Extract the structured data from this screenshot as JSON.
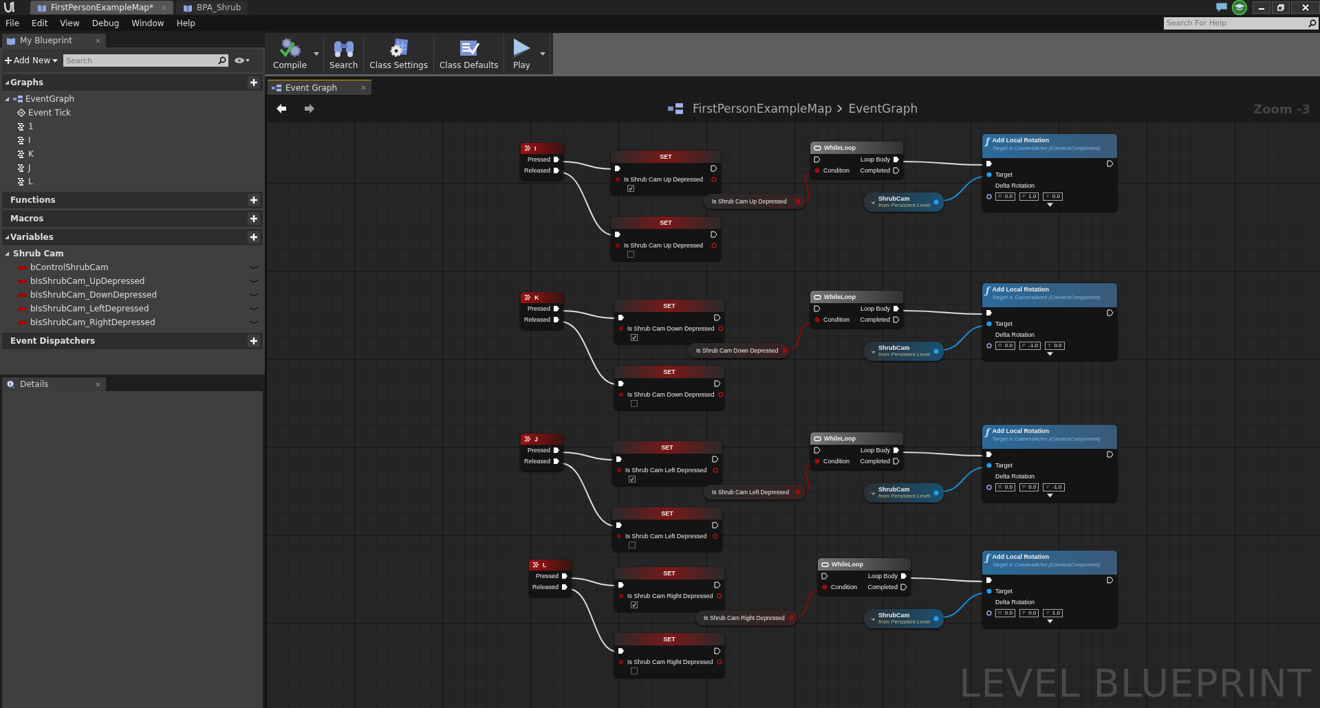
{
  "tabs": [
    {
      "label": "FirstPersonExampleMap*",
      "selected": true
    },
    {
      "label": "BPA_Shrub",
      "selected": false
    }
  ],
  "menu": [
    "File",
    "Edit",
    "View",
    "Debug",
    "Window",
    "Help"
  ],
  "help_search": {
    "placeholder": "Search For Help"
  },
  "my_blueprint": {
    "tab": "My Blueprint",
    "add_new": "Add New",
    "search": {
      "placeholder": "Search"
    },
    "sections": [
      {
        "title": "Graphs",
        "expanded": true,
        "graphs": [
          {
            "label": "EventGraph",
            "expanded": true,
            "children": [
              {
                "label": "Event Tick",
                "kind": "event"
              },
              {
                "label": "1",
                "kind": "key"
              },
              {
                "label": "I",
                "kind": "key"
              },
              {
                "label": "K",
                "kind": "key"
              },
              {
                "label": "J",
                "kind": "key"
              },
              {
                "label": "L",
                "kind": "key"
              }
            ]
          }
        ]
      },
      {
        "title": "Functions",
        "expanded": false
      },
      {
        "title": "Macros",
        "expanded": false
      },
      {
        "title": "Variables",
        "expanded": true,
        "categories": [
          {
            "label": "Shrub Cam",
            "expanded": true,
            "variables": [
              "bControlShrubCam",
              "bIsShrubCam_UpDepressed",
              "bIsShrubCam_DownDepressed",
              "bIsShrubCam_LeftDepressed",
              "bIsShrubCam_RightDepressed"
            ]
          }
        ]
      },
      {
        "title": "Event Dispatchers",
        "expanded": false
      }
    ]
  },
  "details": {
    "tab": "Details"
  },
  "toolbar": [
    {
      "label": "Compile",
      "kind": "compile",
      "dropdown": true
    },
    {
      "label": "Search",
      "kind": "search",
      "dropdown": false
    },
    {
      "label": "Class Settings",
      "kind": "settings",
      "dropdown": false
    },
    {
      "label": "Class Defaults",
      "kind": "defaults",
      "dropdown": false
    },
    {
      "label": "Play",
      "kind": "play",
      "dropdown": true
    }
  ],
  "graph_tab": "Event Graph",
  "breadcrumb": [
    "FirstPersonExampleMap",
    "EventGraph"
  ],
  "zoom": "Zoom -3",
  "graph_label": "LEVEL BLUEPRINT",
  "rows": [
    {
      "key": {
        "title": "I",
        "pressed": "Pressed",
        "released": "Released"
      },
      "set_pressed": {
        "title": "SET",
        "variable": "Is Shrub Cam Up Depressed",
        "checked": true
      },
      "set_released": {
        "title": "SET",
        "variable": "Is Shrub Cam Up Depressed",
        "checked": false
      },
      "getter": "Is Shrub Cam Up Depressed",
      "loop": {
        "title": "WhileLoop",
        "loop_body": "Loop Body",
        "condition": "Condition",
        "completed": "Completed"
      },
      "target": {
        "name": "ShrubCam",
        "source": "from Persistent Level"
      },
      "function": {
        "icon": "ƒ",
        "title": "Add Local Rotation",
        "subtitle": "Target is CameraActor (CameraComponent)",
        "target": "Target",
        "param": "Delta Rotation",
        "fields": [
          {
            "label": "R",
            "value": "0.0"
          },
          {
            "label": "P",
            "value": "1.0"
          },
          {
            "label": "Y",
            "value": "0.0"
          }
        ]
      }
    },
    {
      "key": {
        "title": "K",
        "pressed": "Pressed",
        "released": "Released"
      },
      "set_pressed": {
        "title": "SET",
        "variable": "Is Shrub Cam Down Depressed",
        "checked": true
      },
      "set_released": {
        "title": "SET",
        "variable": "Is Shrub Cam Down Depressed",
        "checked": false
      },
      "getter": "Is Shrub Cam Down Depressed",
      "loop": {
        "title": "WhileLoop",
        "loop_body": "Loop Body",
        "condition": "Condition",
        "completed": "Completed"
      },
      "target": {
        "name": "ShrubCam",
        "source": "from Persistent Level"
      },
      "function": {
        "icon": "ƒ",
        "title": "Add Local Rotation",
        "subtitle": "Target is CameraActor (CameraComponent)",
        "target": "Target",
        "param": "Delta Rotation",
        "fields": [
          {
            "label": "R",
            "value": "0.0"
          },
          {
            "label": "P",
            "value": "-1.0"
          },
          {
            "label": "Y",
            "value": "0.0"
          }
        ]
      }
    },
    {
      "key": {
        "title": "J",
        "pressed": "Pressed",
        "released": "Released"
      },
      "set_pressed": {
        "title": "SET",
        "variable": "Is Shrub Cam Left Depressed",
        "checked": true
      },
      "set_released": {
        "title": "SET",
        "variable": "Is Shrub Cam Left Depressed",
        "checked": false
      },
      "getter": "Is Shrub Cam Left Depressed",
      "loop": {
        "title": "WhileLoop",
        "loop_body": "Loop Body",
        "condition": "Condition",
        "completed": "Completed"
      },
      "target": {
        "name": "ShrubCam",
        "source": "from Persistent Level"
      },
      "function": {
        "icon": "ƒ",
        "title": "Add Local Rotation",
        "subtitle": "Target is CameraActor (CameraComponent)",
        "target": "Target",
        "param": "Delta Rotation",
        "fields": [
          {
            "label": "R",
            "value": "0.0"
          },
          {
            "label": "P",
            "value": "0.0"
          },
          {
            "label": "Y",
            "value": "-1.0"
          }
        ]
      }
    },
    {
      "key": {
        "title": "L",
        "pressed": "Pressed",
        "released": "Released"
      },
      "set_pressed": {
        "title": "SET",
        "variable": "Is Shrub Cam Right Depressed",
        "checked": true
      },
      "set_released": {
        "title": "SET",
        "variable": "Is Shrub Cam Right Depressed",
        "checked": false
      },
      "getter": "Is Shrub Cam Right Depressed",
      "loop": {
        "title": "WhileLoop",
        "loop_body": "Loop Body",
        "condition": "Condition",
        "completed": "Completed"
      },
      "target": {
        "name": "ShrubCam",
        "source": "from Persistent Level"
      },
      "function": {
        "icon": "ƒ",
        "title": "Add Local Rotation",
        "subtitle": "Target is CameraActor (CameraComponent)",
        "target": "Target",
        "param": "Delta Rotation",
        "fields": [
          {
            "label": "R",
            "value": "0.0"
          },
          {
            "label": "P",
            "value": "0.0"
          },
          {
            "label": "Y",
            "value": "1.0"
          }
        ]
      }
    }
  ]
}
